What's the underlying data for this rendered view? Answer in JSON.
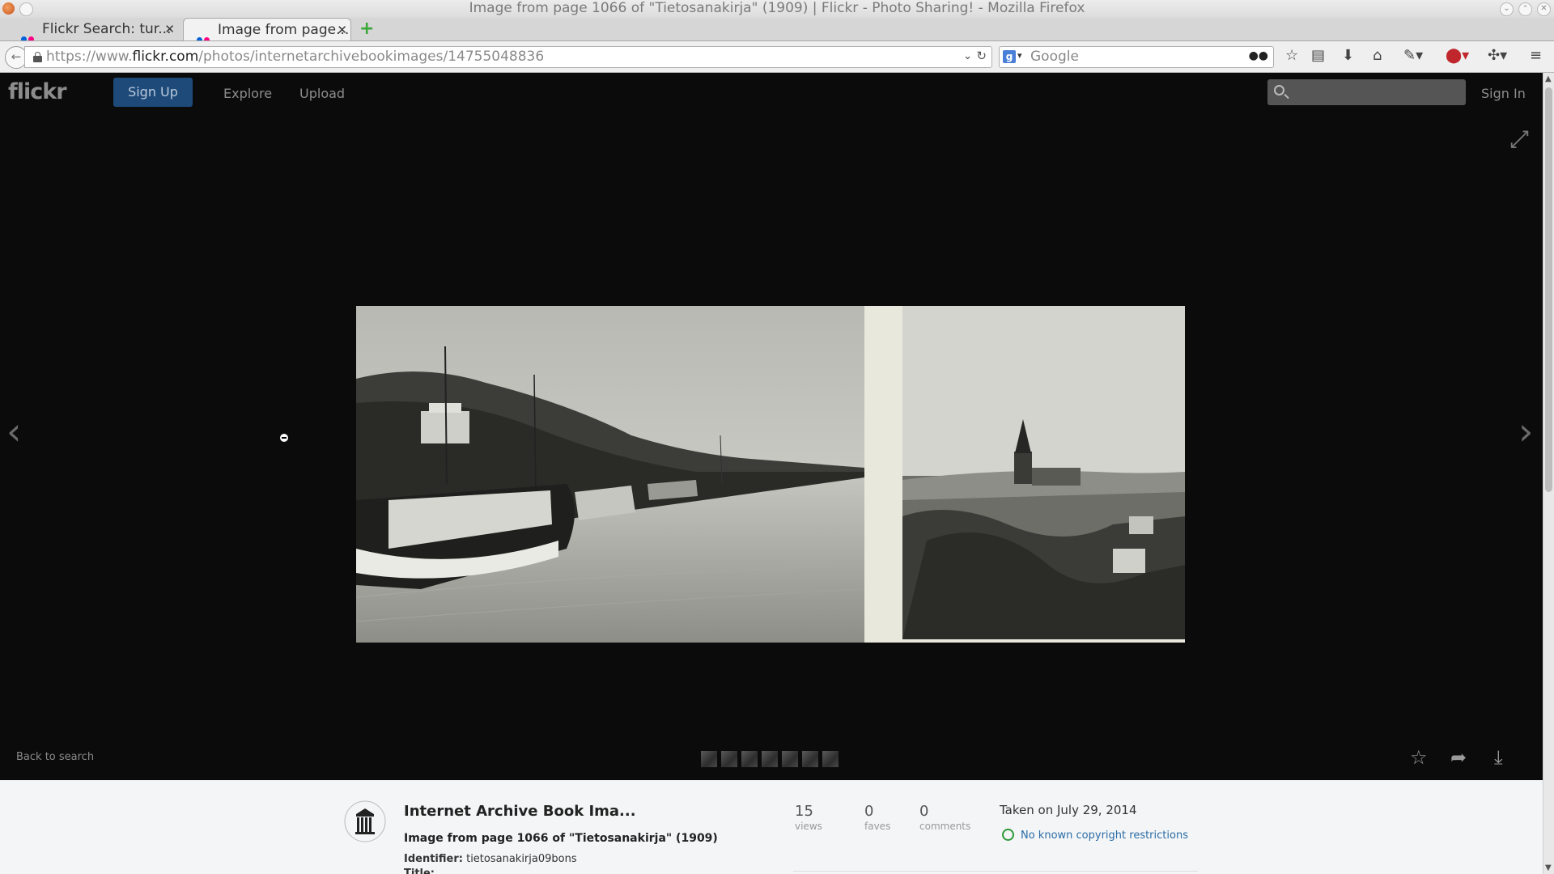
{
  "window": {
    "title": "Image from page 1066 of \"Tietosanakirja\" (1909) | Flickr - Photo Sharing! - Mozilla Firefox"
  },
  "tabs": [
    {
      "label": "Flickr Search: tur...",
      "active": false
    },
    {
      "label": "Image from page...",
      "active": true
    }
  ],
  "browser": {
    "url_prefix": "https://www.",
    "url_domain": "flickr.com",
    "url_path": "/photos/internetarchivebookimages/14755048836",
    "search_placeholder": "Google"
  },
  "flickr": {
    "logo": "flickr",
    "signup_label": "Sign Up",
    "nav": [
      "Explore",
      "Upload"
    ],
    "signin_label": "Sign In",
    "back_to_search": "Back to search"
  },
  "photo_info": {
    "owner": "Internet Archive Book Ima...",
    "title": "Image from page 1066 of \"Tietosanakirja\" (1909)",
    "identifier_label": "Identifier:",
    "identifier_value": "tietosanakirja09bons",
    "title_label_cutoff": "Title:",
    "stats": [
      {
        "value": "15",
        "label": "views"
      },
      {
        "value": "0",
        "label": "faves"
      },
      {
        "value": "0",
        "label": "comments"
      }
    ],
    "taken": "Taken on July 29, 2014",
    "license": "No known copyright restrictions"
  },
  "colors": {
    "page_bg": "#0b0b0b",
    "signup_bg": "#1e4a7a",
    "info_bg": "#f3f5f6",
    "link_blue": "#2b6ca7",
    "license_green": "#2e9a3a"
  },
  "icons": [
    "flickr-dots-icon",
    "close-icon",
    "new-tab-icon",
    "back-icon",
    "lock-icon",
    "reload-icon",
    "google-icon",
    "binoculars-icon",
    "bookmark-star-icon",
    "reading-list-icon",
    "download-icon",
    "home-icon",
    "tools-icon",
    "adblock-icon",
    "addon-icon",
    "menu-icon",
    "search-icon",
    "expand-icon",
    "prev-arrow-icon",
    "next-arrow-icon",
    "favorite-star-icon",
    "share-icon",
    "download-photo-icon"
  ]
}
